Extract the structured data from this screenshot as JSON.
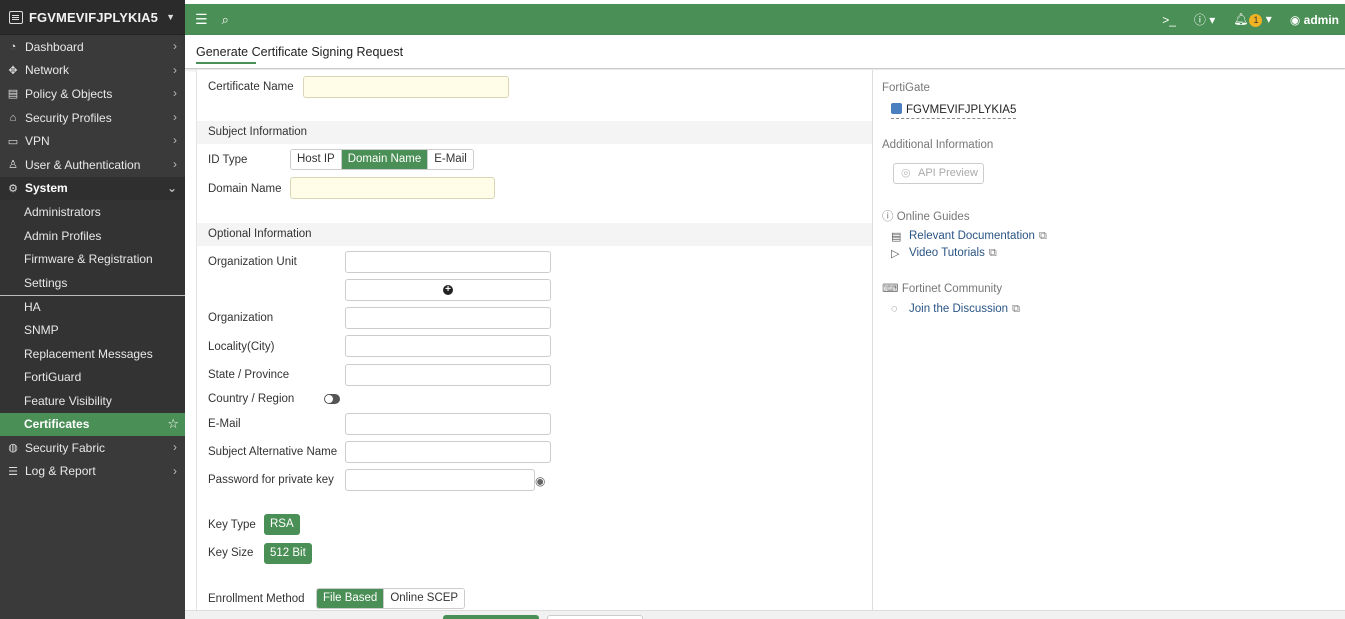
{
  "device": {
    "name": "FGVMEVIFJPLYKIA5"
  },
  "sidebar": {
    "items": [
      {
        "label": "Dashboard",
        "icon": "dashboard-icon"
      },
      {
        "label": "Network",
        "icon": "network-icon"
      },
      {
        "label": "Policy & Objects",
        "icon": "policy-icon"
      },
      {
        "label": "Security Profiles",
        "icon": "lock-icon"
      },
      {
        "label": "VPN",
        "icon": "monitor-icon"
      },
      {
        "label": "User & Authentication",
        "icon": "user-icon"
      },
      {
        "label": "System",
        "icon": "gear-icon"
      }
    ],
    "system_sub": [
      "Administrators",
      "Admin Profiles",
      "Firmware & Registration",
      "Settings",
      "HA",
      "SNMP",
      "Replacement Messages",
      "FortiGuard",
      "Feature Visibility",
      "Certificates"
    ],
    "after": [
      {
        "label": "Security Fabric",
        "icon": "fabric-icon"
      },
      {
        "label": "Log & Report",
        "icon": "report-icon"
      }
    ]
  },
  "topbar": {
    "notifications": "1",
    "user": "admin"
  },
  "page": {
    "title": "Generate Certificate Signing Request"
  },
  "form": {
    "certificate_name_label": "Certificate Name",
    "subject_section": "Subject Information",
    "id_type_label": "ID Type",
    "id_types": [
      "Host IP",
      "Domain Name",
      "E-Mail"
    ],
    "domain_name_label": "Domain Name",
    "optional_section": "Optional Information",
    "org_unit_label": "Organization Unit",
    "organization_label": "Organization",
    "locality_label": "Locality(City)",
    "state_label": "State / Province",
    "country_label": "Country / Region",
    "email_label": "E-Mail",
    "san_label": "Subject Alternative Name",
    "password_label": "Password for private key",
    "key_type_label": "Key Type",
    "key_type_value": "RSA",
    "key_size_label": "Key Size",
    "key_size_value": "512 Bit",
    "enrollment_label": "Enrollment Method",
    "enrollment_options": [
      "File Based",
      "Online SCEP"
    ]
  },
  "right_panel": {
    "fortigate_head": "FortiGate",
    "fortigate_name": "FGVMEVIFJPLYKIA5",
    "additional_head": "Additional Information",
    "api_preview": "API Preview",
    "guides_head": "Online Guides",
    "relevant_docs": "Relevant Documentation",
    "video_tutorials": "Video Tutorials",
    "community_head": "Fortinet Community",
    "join_discussion": "Join the Discussion"
  },
  "colors": {
    "accent": "#4a8f55",
    "sidebar": "#3a3a3a",
    "badge": "#f0b323"
  }
}
